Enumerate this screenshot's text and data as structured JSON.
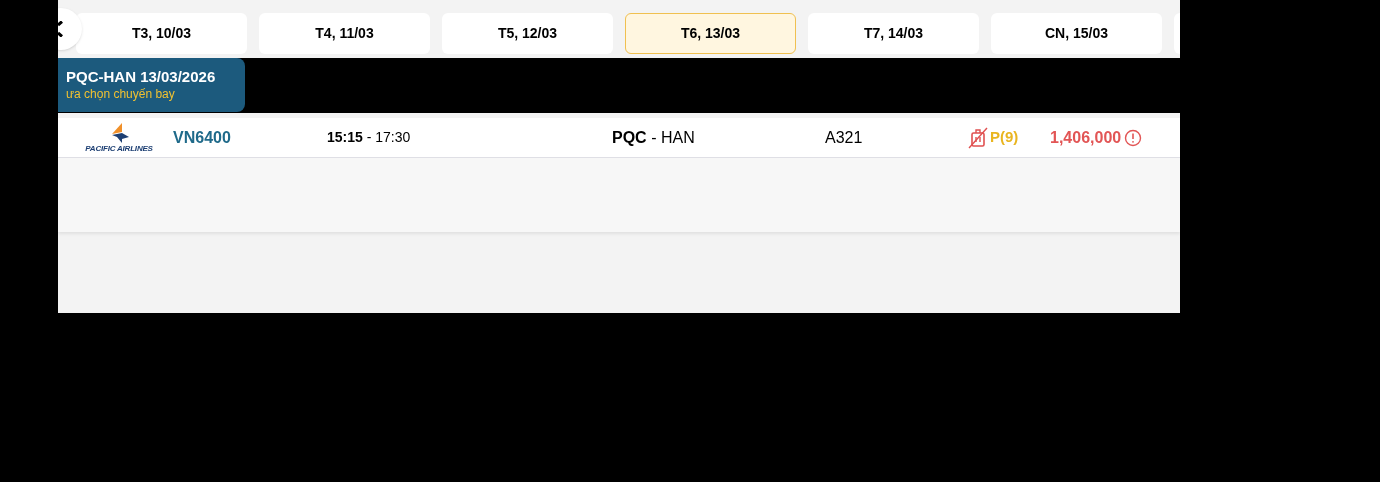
{
  "date_tabs": [
    {
      "label": "T3, 10/03",
      "selected": false
    },
    {
      "label": "T4, 11/03",
      "selected": false
    },
    {
      "label": "T5, 12/03",
      "selected": false
    },
    {
      "label": "T6, 13/03",
      "selected": true
    },
    {
      "label": "T7, 14/03",
      "selected": false
    },
    {
      "label": "CN, 15/03",
      "selected": false
    }
  ],
  "leg_tab": {
    "title": "PQC-HAN 13/03/2026",
    "subtitle": "ưa chọn chuyến bay"
  },
  "flights": [
    {
      "airline_logo_text": "PACIFIC AIRLINES",
      "flight_number": "VN6400",
      "departure": "15:15",
      "separator": "-",
      "arrival": "17:30",
      "origin": "PQC",
      "route_separator": "-",
      "destination": "HAN",
      "aircraft": "A321",
      "baggage_included": false,
      "fare_class": "P(9)",
      "price": "1,406,000"
    }
  ]
}
